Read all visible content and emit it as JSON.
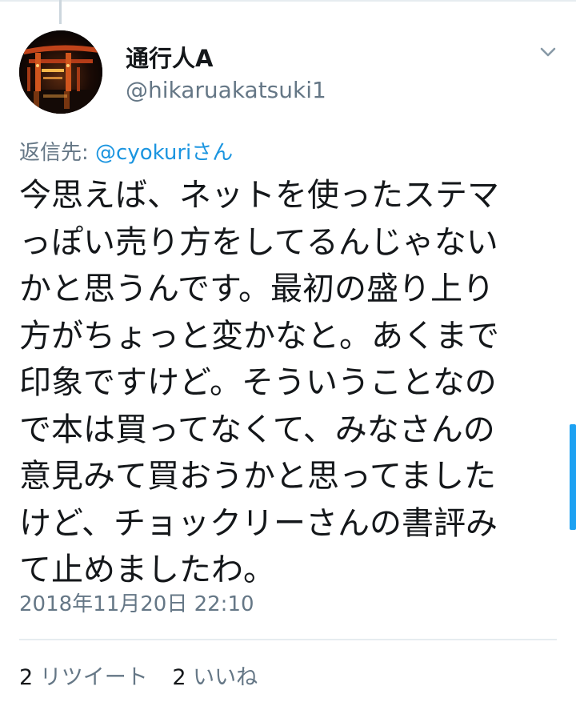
{
  "author": {
    "display_name": "通行人A",
    "handle": "@hikaruakatsuki1"
  },
  "reply": {
    "prefix": "返信先: ",
    "mention": "@cyokuri",
    "suffix": "さん"
  },
  "tweet": {
    "lines": [
      "今思えば、ネットを使ったステマ",
      "っぽい売り方をしてるんじゃない",
      "かと思うんです。最初の盛り上り",
      "方がちょっと変かなと。あくまで",
      "印象ですけど。そういうことなの",
      "で本は買ってなくて、みなさんの",
      "意見みて買おうかと思ってました",
      "けど、チョックリーさんの書評み",
      "て止めましたわ。"
    ],
    "timestamp": "2018年11月20日 22:10"
  },
  "stats": {
    "retweet_count": "2",
    "retweet_label": "リツイート",
    "like_count": "2",
    "like_label": "いいね"
  },
  "colors": {
    "text": "#14171a",
    "secondary": "#657786",
    "link": "#1b95e0",
    "divider": "#e6ecf0",
    "accent": "#1da1f2"
  },
  "icons": {
    "more_menu": "chevron-down-icon",
    "avatar": "torii-gate-night-photo"
  }
}
